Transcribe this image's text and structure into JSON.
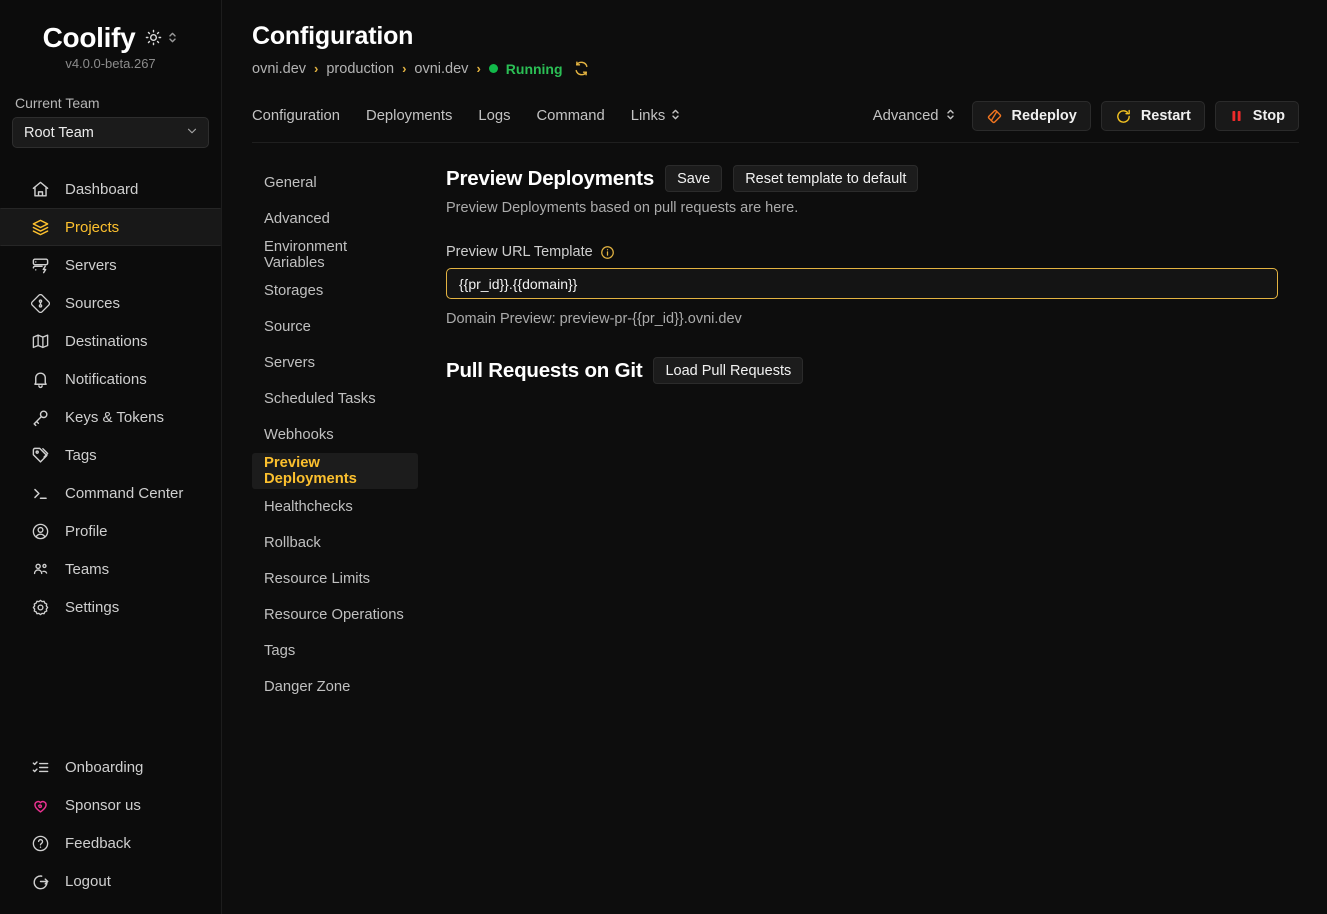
{
  "sidebar": {
    "brand": "Coolify",
    "version": "v4.0.0-beta.267",
    "theme_icon": "sun-icon",
    "theme_chevrons_icon": "chevron-up-down-icon",
    "team_label": "Current Team",
    "team_value": "Root Team",
    "nav_main": [
      {
        "label": "Dashboard",
        "icon": "home-icon",
        "active": false
      },
      {
        "label": "Projects",
        "icon": "layers-icon",
        "active": true
      },
      {
        "label": "Servers",
        "icon": "server-icon",
        "active": false
      },
      {
        "label": "Sources",
        "icon": "git-source-icon",
        "active": false
      },
      {
        "label": "Destinations",
        "icon": "map-icon",
        "active": false
      },
      {
        "label": "Notifications",
        "icon": "bell-icon",
        "active": false
      },
      {
        "label": "Keys & Tokens",
        "icon": "key-icon",
        "active": false
      },
      {
        "label": "Tags",
        "icon": "tag-icon",
        "active": false
      },
      {
        "label": "Command Center",
        "icon": "terminal-icon",
        "active": false
      },
      {
        "label": "Profile",
        "icon": "user-circle-icon",
        "active": false
      },
      {
        "label": "Teams",
        "icon": "users-icon",
        "active": false
      },
      {
        "label": "Settings",
        "icon": "gear-icon",
        "active": false
      }
    ],
    "nav_bottom": [
      {
        "label": "Onboarding",
        "icon": "checklist-icon"
      },
      {
        "label": "Sponsor us",
        "icon": "heart-icon"
      },
      {
        "label": "Feedback",
        "icon": "question-circle-icon"
      },
      {
        "label": "Logout",
        "icon": "logout-icon"
      }
    ]
  },
  "header": {
    "title": "Configuration",
    "breadcrumb": [
      "ovni.dev",
      "production",
      "ovni.dev"
    ],
    "separator": "›",
    "status": "Running",
    "status_color": "#2bbf55",
    "refresh_icon": "refresh-icon"
  },
  "tabs": {
    "items": [
      {
        "label": "Configuration"
      },
      {
        "label": "Deployments"
      },
      {
        "label": "Logs"
      },
      {
        "label": "Command"
      }
    ],
    "links_label": "Links",
    "advanced_label": "Advanced"
  },
  "actions": {
    "redeploy": {
      "label": "Redeploy",
      "icon": "redeploy-icon",
      "color": "#f0741f"
    },
    "restart": {
      "label": "Restart",
      "icon": "restart-icon",
      "color": "#f3c222"
    },
    "stop": {
      "label": "Stop",
      "icon": "pause-icon",
      "color": "#ef2b2b"
    }
  },
  "submenu": [
    {
      "label": "General",
      "active": false
    },
    {
      "label": "Advanced",
      "active": false
    },
    {
      "label": "Environment Variables",
      "active": false
    },
    {
      "label": "Storages",
      "active": false
    },
    {
      "label": "Source",
      "active": false
    },
    {
      "label": "Servers",
      "active": false
    },
    {
      "label": "Scheduled Tasks",
      "active": false
    },
    {
      "label": "Webhooks",
      "active": false
    },
    {
      "label": "Preview Deployments",
      "active": true
    },
    {
      "label": "Healthchecks",
      "active": false
    },
    {
      "label": "Rollback",
      "active": false
    },
    {
      "label": "Resource Limits",
      "active": false
    },
    {
      "label": "Resource Operations",
      "active": false
    },
    {
      "label": "Tags",
      "active": false
    },
    {
      "label": "Danger Zone",
      "active": false
    }
  ],
  "content": {
    "section_title": "Preview Deployments",
    "save_label": "Save",
    "reset_label": "Reset template to default",
    "description": "Preview Deployments based on pull requests are here.",
    "url_field_label": "Preview URL Template",
    "url_info_icon": "info-icon",
    "url_value": "{{pr_id}}.{{domain}}",
    "url_placeholder": "{{pr_id}}.{{domain}}",
    "domain_preview": "Domain Preview: preview-pr-{{pr_id}}.ovni.dev",
    "pull_requests_title": "Pull Requests on Git",
    "load_pull_requests_label": "Load Pull Requests"
  },
  "colors": {
    "accent": "#fcc02e",
    "border_accent": "#e3b341",
    "background": "#0d0d0d",
    "sidebar_background": "#0c0c0c"
  }
}
